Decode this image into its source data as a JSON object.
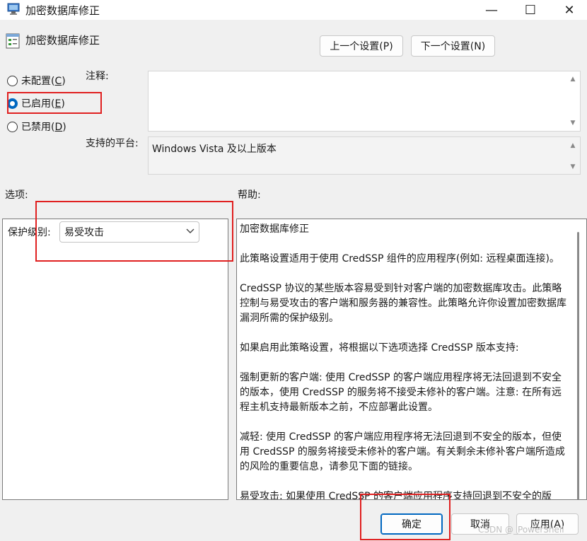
{
  "window": {
    "title": "加密数据库修正",
    "minimize_glyph": "—",
    "maximize_glyph": "☐",
    "close_glyph": "✕"
  },
  "header": {
    "title": "加密数据库修正",
    "prev_label": "上一个设置(P)",
    "next_label": "下一个设置(N)"
  },
  "state": {
    "options": [
      {
        "label_main": "未配置(",
        "key": "C",
        "label_end": ")",
        "checked": false
      },
      {
        "label_main": "已启用(",
        "key": "E",
        "label_end": ")",
        "checked": true
      },
      {
        "label_main": "已禁用(",
        "key": "D",
        "label_end": ")",
        "checked": false
      }
    ]
  },
  "comment": {
    "label": "注释:",
    "value": ""
  },
  "platform": {
    "label": "支持的平台:",
    "value": "Windows Vista 及以上版本"
  },
  "options_section": {
    "label": "选项:",
    "protection_label": "保护级别:",
    "protection_value": "易受攻击"
  },
  "help_section": {
    "label": "帮助:",
    "paragraphs": [
      "加密数据库修正",
      "此策略设置适用于使用 CredSSP 组件的应用程序(例如: 远程桌面连接)。",
      "CredSSP 协议的某些版本容易受到针对客户端的加密数据库攻击。此策略控制与易受攻击的客户端和服务器的兼容性。此策略允许你设置加密数据库漏洞所需的保护级别。",
      "如果启用此策略设置，将根据以下选项选择 CredSSP 版本支持:",
      "强制更新的客户端: 使用 CredSSP 的客户端应用程序将无法回退到不安全的版本，使用 CredSSP 的服务将不接受未修补的客户端。注意: 在所有远程主机支持最新版本之前，不应部署此设置。",
      "减轻: 使用 CredSSP 的客户端应用程序将无法回退到不安全的版本，但使用 CredSSP 的服务将接受未修补的客户端。有关剩余未修补客户端所造成的风险的重要信息，请参见下面的链接。",
      "易受攻击: 如果使用 CredSSP 的客户端应用程序支持回退到不安全的版本，远程服务器将容易遭受攻击。使用 CredSSP 的服务将接受未修补的"
    ]
  },
  "footer": {
    "ok_label": "确定",
    "cancel_label": "取消",
    "apply_label": "应用(A)"
  },
  "watermark": "CSDN @_PowerShell",
  "colors": {
    "accent": "#0067c0",
    "highlight": "#e02020"
  },
  "icons": {
    "title": "policy-window-icon",
    "header": "policy-setting-icon",
    "chevron": "chevron-down-icon"
  }
}
